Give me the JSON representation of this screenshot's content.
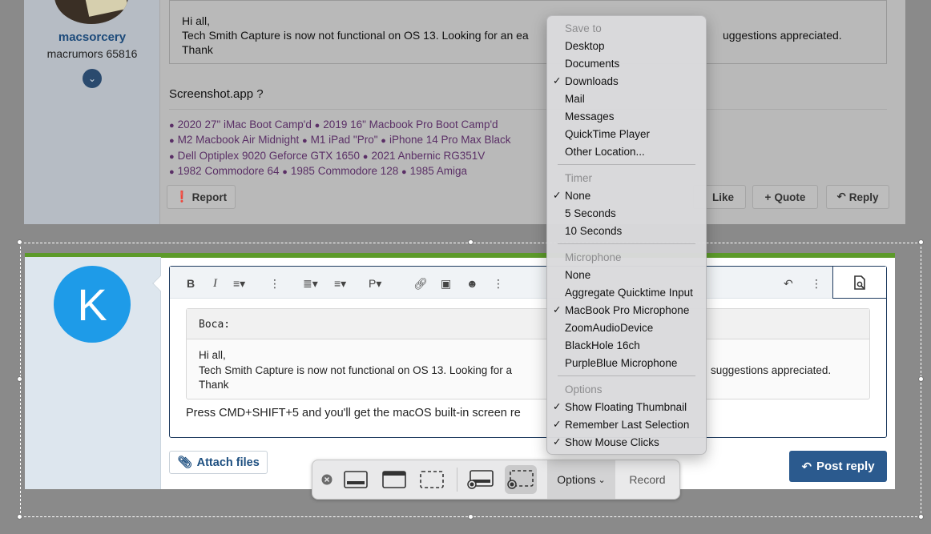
{
  "thread_post": {
    "username": "macsorcery",
    "user_title": "macrumors 65816",
    "quote_lines": [
      "Hi all,",
      "Tech Smith Capture is now not functional on OS 13.  Looking for an ea",
      "uggestions appreciated.",
      "Thank"
    ],
    "post_text": "Screenshot.app ?",
    "signature": [
      [
        "2020 27\" iMac Boot Camp'd",
        "2019 16\" Macbook Pro Boot Camp'd"
      ],
      [
        "M2 Macbook Air Midnight",
        "M1 iPad \"Pro\"",
        "iPhone 14 Pro Max Black"
      ],
      [
        "Dell Optiplex 9020 Geforce GTX 1650",
        "2021 Anbernic RG351V"
      ],
      [
        "1982 Commodore 64",
        "1985 Commodore 128",
        "1985 Amiga"
      ]
    ],
    "actions": {
      "report": "Report",
      "like": "Like",
      "quote": "Quote",
      "reply": "Reply"
    }
  },
  "reply_editor": {
    "avatar_letter": "K",
    "toolbar_icons": [
      "bold-icon",
      "italic-icon",
      "font-size-icon",
      "more-icon",
      "list-icon",
      "align-icon",
      "paragraph-icon",
      "more-icon",
      "link-icon",
      "image-icon",
      "emoji-icon",
      "more-icon",
      "undo-icon",
      "more-icon",
      "preview-icon"
    ],
    "quote_author": "Boca:",
    "quote_lines": [
      "Hi all,",
      "Tech Smith Capture is now not functional on OS 13.  Looking for a",
      "suggestions appreciated.",
      "Thank"
    ],
    "reply_text": "Press CMD+SHIFT+5 and you'll get the macOS built-in screen re",
    "attach_label": "Attach files",
    "post_label": "Post reply"
  },
  "screenshot_toolbar": {
    "options_label": "Options",
    "record_label": "Record",
    "selected_tool": "record-selected-portion"
  },
  "options_menu": {
    "save_to": {
      "header": "Save to",
      "items": [
        "Desktop",
        "Documents",
        "Downloads",
        "Mail",
        "Messages",
        "QuickTime Player",
        "Other Location..."
      ],
      "checked": "Downloads"
    },
    "timer": {
      "header": "Timer",
      "items": [
        "None",
        "5 Seconds",
        "10 Seconds"
      ],
      "checked": "None"
    },
    "microphone": {
      "header": "Microphone",
      "items": [
        "None",
        "Aggregate Quicktime Input",
        "MacBook Pro Microphone",
        "ZoomAudioDevice",
        "BlackHole 16ch",
        "PurpleBlue Microphone"
      ],
      "checked": "MacBook Pro Microphone"
    },
    "options": {
      "header": "Options",
      "items": [
        "Show Floating Thumbnail",
        "Remember Last Selection",
        "Show Mouse Clicks"
      ]
    }
  },
  "colors": {
    "accent": "#2b5a8e",
    "green_bar": "#5c9a2a",
    "avatar": "#1e9be8",
    "signature": "#5a2f66"
  }
}
